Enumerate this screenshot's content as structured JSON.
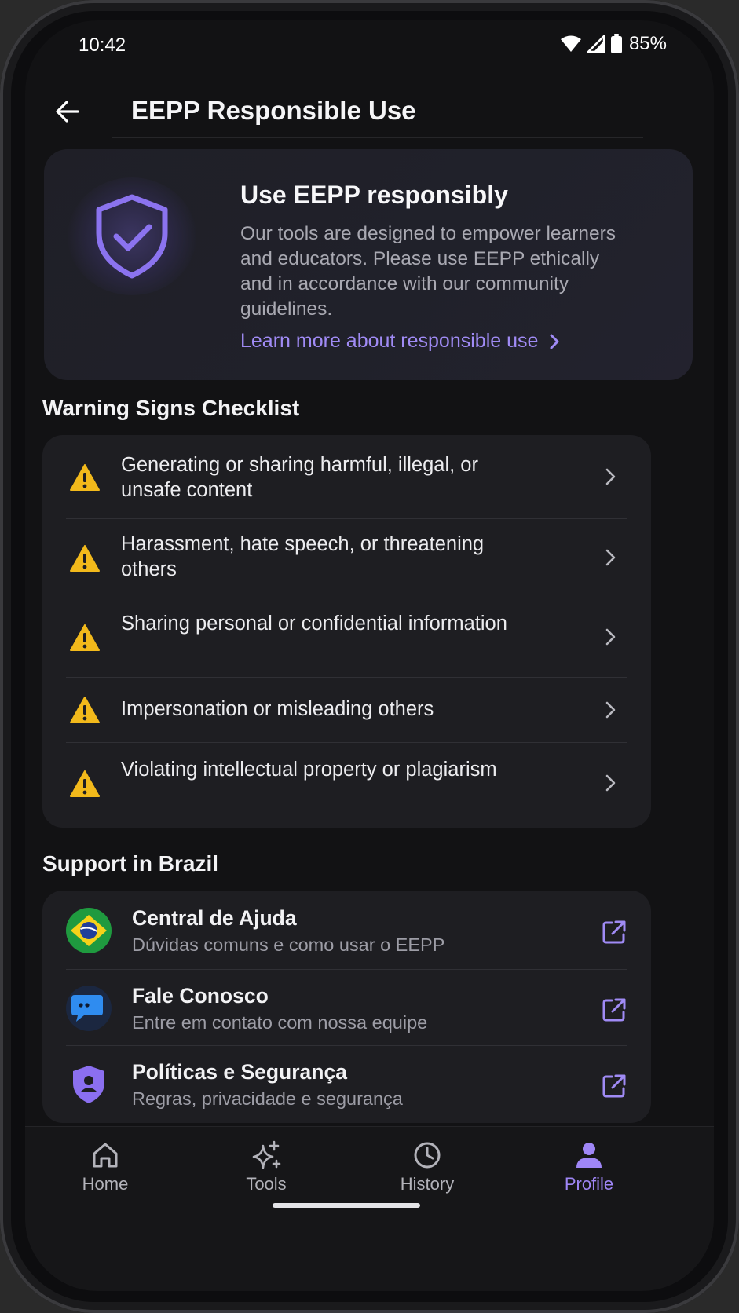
{
  "status_bar": {
    "time": "10:42",
    "battery": "85%"
  },
  "header": {
    "title": "EEPP Responsible Use"
  },
  "hero": {
    "title": "Use EEPP responsibly",
    "description": "Our tools are designed to empower learners and educators. Please use EEPP ethically and in accordance with our community guidelines.",
    "link": "Learn more about responsible use"
  },
  "warning_section": {
    "title": "Warning Signs Checklist",
    "items": [
      {
        "label": "Generating or sharing harmful, illegal, or unsafe content"
      },
      {
        "label": "Harassment, hate speech, or threatening others"
      },
      {
        "label": "Sharing personal or confidential information"
      },
      {
        "label": "Impersonation or misleading others"
      },
      {
        "label": "Violating intellectual property or plagiarism"
      }
    ]
  },
  "support_section": {
    "title": "Support in Brazil",
    "items": [
      {
        "title": "Central de Ajuda",
        "subtitle": "Dúvidas comuns e como usar o EEPP",
        "icon": "brazil-flag-icon"
      },
      {
        "title": "Fale Conosco",
        "subtitle": "Entre em contato com nossa equipe",
        "icon": "chat-bubbles-icon"
      },
      {
        "title": "Políticas e Segurança",
        "subtitle": "Regras, privacidade e segurança",
        "icon": "shield-user-icon"
      }
    ]
  },
  "bottom_nav": {
    "items": [
      {
        "label": "Home",
        "icon": "home-icon"
      },
      {
        "label": "Tools",
        "icon": "sparkles-icon"
      },
      {
        "label": "History",
        "icon": "clock-icon"
      },
      {
        "label": "Profile",
        "icon": "person-icon",
        "active": true
      }
    ]
  },
  "colors": {
    "accent": "#9f86f6",
    "warning": "#f2b91b",
    "background": "#121214",
    "card": "#1e1e22"
  }
}
